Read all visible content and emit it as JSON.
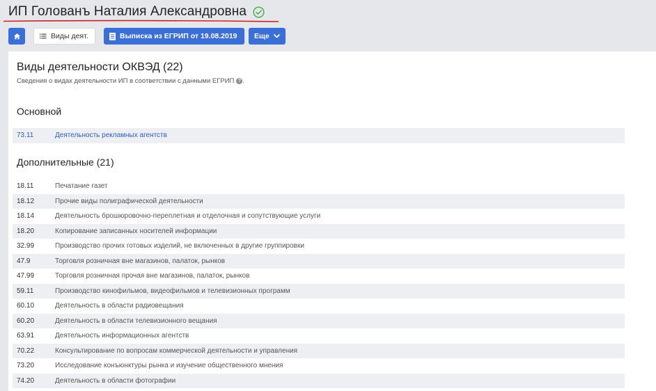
{
  "header": {
    "title": "ИП Голованъ Наталия Александровна",
    "status_icon": "check-circle-icon",
    "accent_underline_color": "#cc2222"
  },
  "toolbar": {
    "home_icon": "home-icon",
    "activity_label": "Виды деят.",
    "extract_label": "Выписка из ЕГРИП от 19.08.2019",
    "more_label": "Еще",
    "button_color": "#3b6fd8"
  },
  "panel": {
    "title": "Виды деятельности ОКВЭД (22)",
    "subtitle": "Сведения о видах деятельности ИП в соответствии с данными ЕГРИП",
    "main_heading": "Основной",
    "extra_heading": "Дополнительные (21)",
    "main_rows": [
      {
        "code": "73.11",
        "name": "Деятельность рекламных агентств"
      }
    ],
    "extra_rows": [
      {
        "code": "18.11",
        "name": "Печатание газет"
      },
      {
        "code": "18.12",
        "name": "Прочие виды полиграфической деятельности"
      },
      {
        "code": "18.14",
        "name": "Деятельность брошюровочно-переплетная и отделочная и сопутствующие услуги"
      },
      {
        "code": "18.20",
        "name": "Копирование записанных носителей информации"
      },
      {
        "code": "32.99",
        "name": "Производство прочих готовых изделий, не включенных в другие группировки"
      },
      {
        "code": "47.9",
        "name": "Торговля розничная вне магазинов, палаток, рынков"
      },
      {
        "code": "47.99",
        "name": "Торговля розничная прочая вне магазинов, палаток, рынков"
      },
      {
        "code": "59.11",
        "name": "Производство кинофильмов, видеофильмов и телевизионных программ"
      },
      {
        "code": "60.10",
        "name": "Деятельность в области радиовещания"
      },
      {
        "code": "60.20",
        "name": "Деятельность в области телевизионного вещания"
      },
      {
        "code": "63.91",
        "name": "Деятельность информационных агентств"
      },
      {
        "code": "70.22",
        "name": "Консультирование по вопросам коммерческой деятельности и управления"
      },
      {
        "code": "73.20",
        "name": "Исследование конъюнктуры рынка и изучение общественного мнения"
      },
      {
        "code": "74.20",
        "name": "Деятельность в области фотографии"
      }
    ]
  }
}
